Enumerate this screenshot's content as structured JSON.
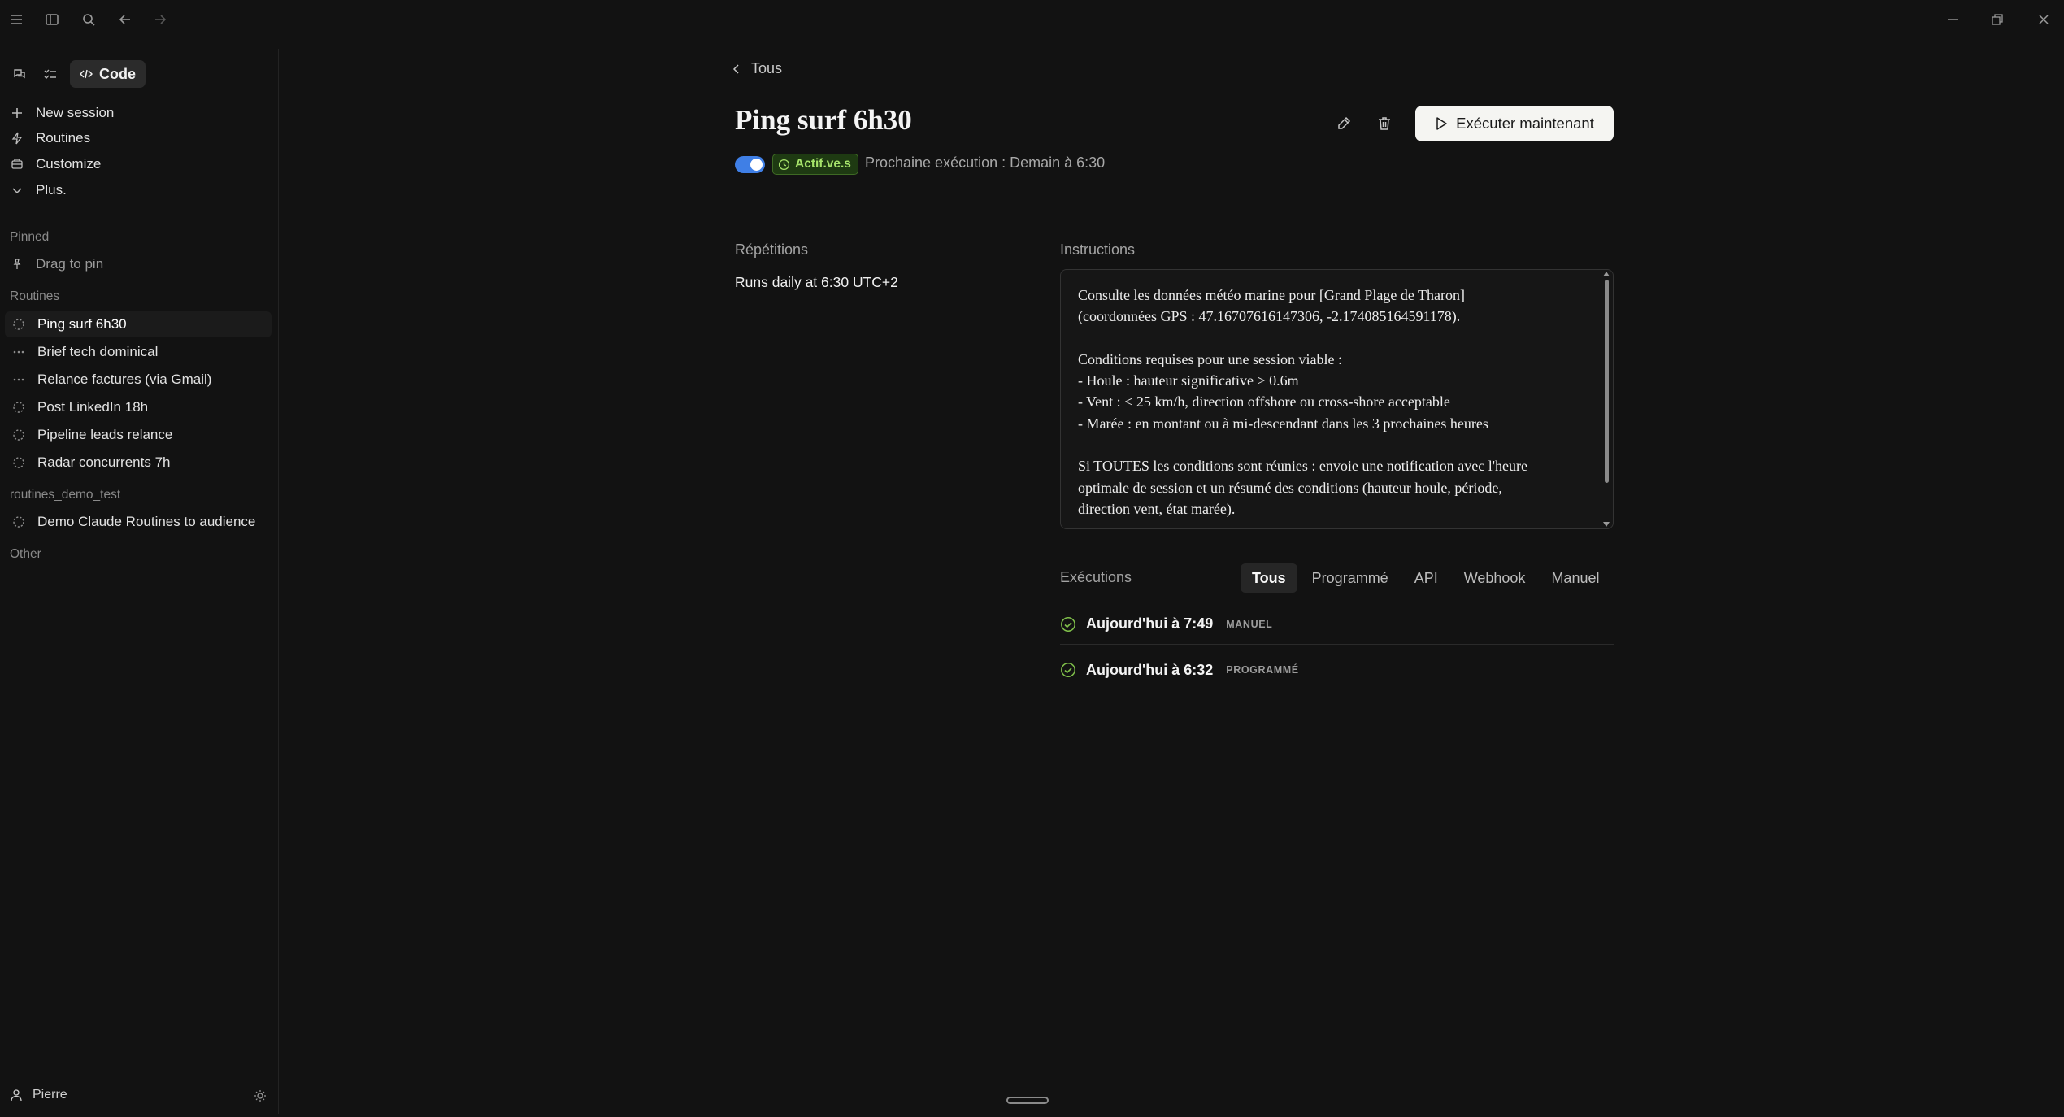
{
  "sidebar": {
    "mode_tab_label": "Code",
    "nav": [
      {
        "label": "New session",
        "icon": "plus-icon"
      },
      {
        "label": "Routines",
        "icon": "routines-icon"
      },
      {
        "label": "Customize",
        "icon": "customize-icon"
      },
      {
        "label": "Plus.",
        "icon": "chevron-down-icon"
      }
    ],
    "pinned_label": "Pinned",
    "drag_to_pin": "Drag to pin",
    "routines_label": "Routines",
    "routines": [
      {
        "label": "Ping surf 6h30",
        "icon": "dashed-circle-icon",
        "active": true
      },
      {
        "label": "Brief tech dominical",
        "icon": "ellipsis-icon"
      },
      {
        "label": "Relance factures (via Gmail)",
        "icon": "ellipsis-icon"
      },
      {
        "label": "Post LinkedIn 18h",
        "icon": "dashed-circle-icon"
      },
      {
        "label": "Pipeline leads relance",
        "icon": "dashed-circle-icon"
      },
      {
        "label": "Radar concurrents 7h",
        "icon": "dashed-circle-icon"
      }
    ],
    "project_label": "routines_demo_test",
    "project_items": [
      {
        "label": "Demo Claude Routines to audience",
        "icon": "dashed-circle-icon"
      }
    ],
    "other_label": "Other",
    "user_name": "Pierre"
  },
  "main": {
    "back_label": "Tous",
    "title": "Ping surf 6h30",
    "run_button_label": "Exécuter maintenant",
    "status_badge": "Actif.ve.s",
    "next_run": "Prochaine exécution : Demain à 6:30",
    "toggle_on": true,
    "repetitions_label": "Répétitions",
    "schedule": "Runs daily at 6:30 UTC+2",
    "instructions_label": "Instructions",
    "instructions": "Consulte les données météo marine pour [Grand Plage de Tharon]\n(coordonnées GPS : 47.16707616147306, -2.174085164591178).\n\nConditions requises pour une session viable :\n- Houle : hauteur significative > 0.6m\n- Vent : < 25 km/h, direction offshore ou cross-shore acceptable\n- Marée : en montant ou à mi-descendant dans les 3 prochaines heures\n\nSi TOUTES les conditions sont réunies : envoie une notification avec l'heure\noptimale de session et un résumé des conditions (hauteur houle, période,\ndirection vent, état marée).",
    "executions_label": "Exécutions",
    "filters": [
      {
        "label": "Tous",
        "active": true
      },
      {
        "label": "Programmé"
      },
      {
        "label": "API"
      },
      {
        "label": "Webhook"
      },
      {
        "label": "Manuel"
      }
    ],
    "executions": [
      {
        "time": "Aujourd'hui à 7:49",
        "tag": "MANUEL",
        "status": "success"
      },
      {
        "time": "Aujourd'hui à 6:32",
        "tag": "PROGRAMMÉ",
        "status": "success"
      }
    ]
  },
  "colors": {
    "background": "#121212",
    "toggle_accent": "#3f7fe6",
    "status_green": "#a6e36a",
    "success_green": "#7fbf4a"
  }
}
